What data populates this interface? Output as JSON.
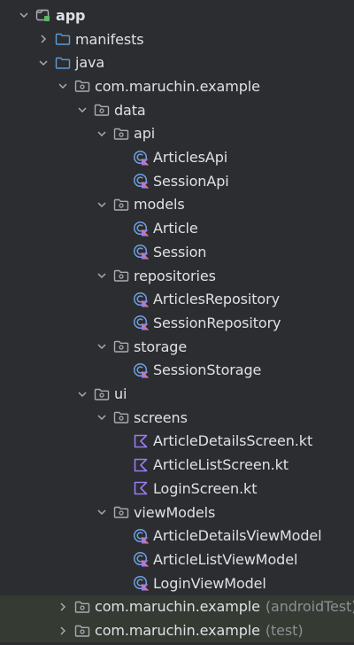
{
  "rows": [
    {
      "depth": 0,
      "arrow": "down",
      "icon": "module",
      "label": "app",
      "bold": true
    },
    {
      "depth": 1,
      "arrow": "right",
      "icon": "folder-blue",
      "label": "manifests"
    },
    {
      "depth": 1,
      "arrow": "down",
      "icon": "folder-blue",
      "label": "java"
    },
    {
      "depth": 2,
      "arrow": "down",
      "icon": "package",
      "label": "com.maruchin.example"
    },
    {
      "depth": 3,
      "arrow": "down",
      "icon": "package",
      "label": "data"
    },
    {
      "depth": 4,
      "arrow": "down",
      "icon": "package",
      "label": "api"
    },
    {
      "depth": 5,
      "arrow": "none",
      "icon": "kotlin-class",
      "label": "ArticlesApi"
    },
    {
      "depth": 5,
      "arrow": "none",
      "icon": "kotlin-class",
      "label": "SessionApi"
    },
    {
      "depth": 4,
      "arrow": "down",
      "icon": "package",
      "label": "models"
    },
    {
      "depth": 5,
      "arrow": "none",
      "icon": "kotlin-class",
      "label": "Article"
    },
    {
      "depth": 5,
      "arrow": "none",
      "icon": "kotlin-class",
      "label": "Session"
    },
    {
      "depth": 4,
      "arrow": "down",
      "icon": "package",
      "label": "repositories"
    },
    {
      "depth": 5,
      "arrow": "none",
      "icon": "kotlin-class",
      "label": "ArticlesRepository"
    },
    {
      "depth": 5,
      "arrow": "none",
      "icon": "kotlin-class",
      "label": "SessionRepository"
    },
    {
      "depth": 4,
      "arrow": "down",
      "icon": "package",
      "label": "storage"
    },
    {
      "depth": 5,
      "arrow": "none",
      "icon": "kotlin-class",
      "label": "SessionStorage"
    },
    {
      "depth": 3,
      "arrow": "down",
      "icon": "package",
      "label": "ui"
    },
    {
      "depth": 4,
      "arrow": "down",
      "icon": "package",
      "label": "screens"
    },
    {
      "depth": 5,
      "arrow": "none",
      "icon": "kotlin-file",
      "label": "ArticleDetailsScreen.kt"
    },
    {
      "depth": 5,
      "arrow": "none",
      "icon": "kotlin-file",
      "label": "ArticleListScreen.kt"
    },
    {
      "depth": 5,
      "arrow": "none",
      "icon": "kotlin-file",
      "label": "LoginScreen.kt"
    },
    {
      "depth": 4,
      "arrow": "down",
      "icon": "package",
      "label": "viewModels"
    },
    {
      "depth": 5,
      "arrow": "none",
      "icon": "kotlin-class",
      "label": "ArticleDetailsViewModel"
    },
    {
      "depth": 5,
      "arrow": "none",
      "icon": "kotlin-class",
      "label": "ArticleListViewModel"
    },
    {
      "depth": 5,
      "arrow": "none",
      "icon": "kotlin-class",
      "label": "LoginViewModel"
    },
    {
      "depth": 2,
      "arrow": "right",
      "icon": "package",
      "label": "com.maruchin.example",
      "suffix": "(androidTest)",
      "highlight": true
    },
    {
      "depth": 2,
      "arrow": "right",
      "icon": "package",
      "label": "com.maruchin.example",
      "suffix": "(test)",
      "highlight": true
    }
  ]
}
